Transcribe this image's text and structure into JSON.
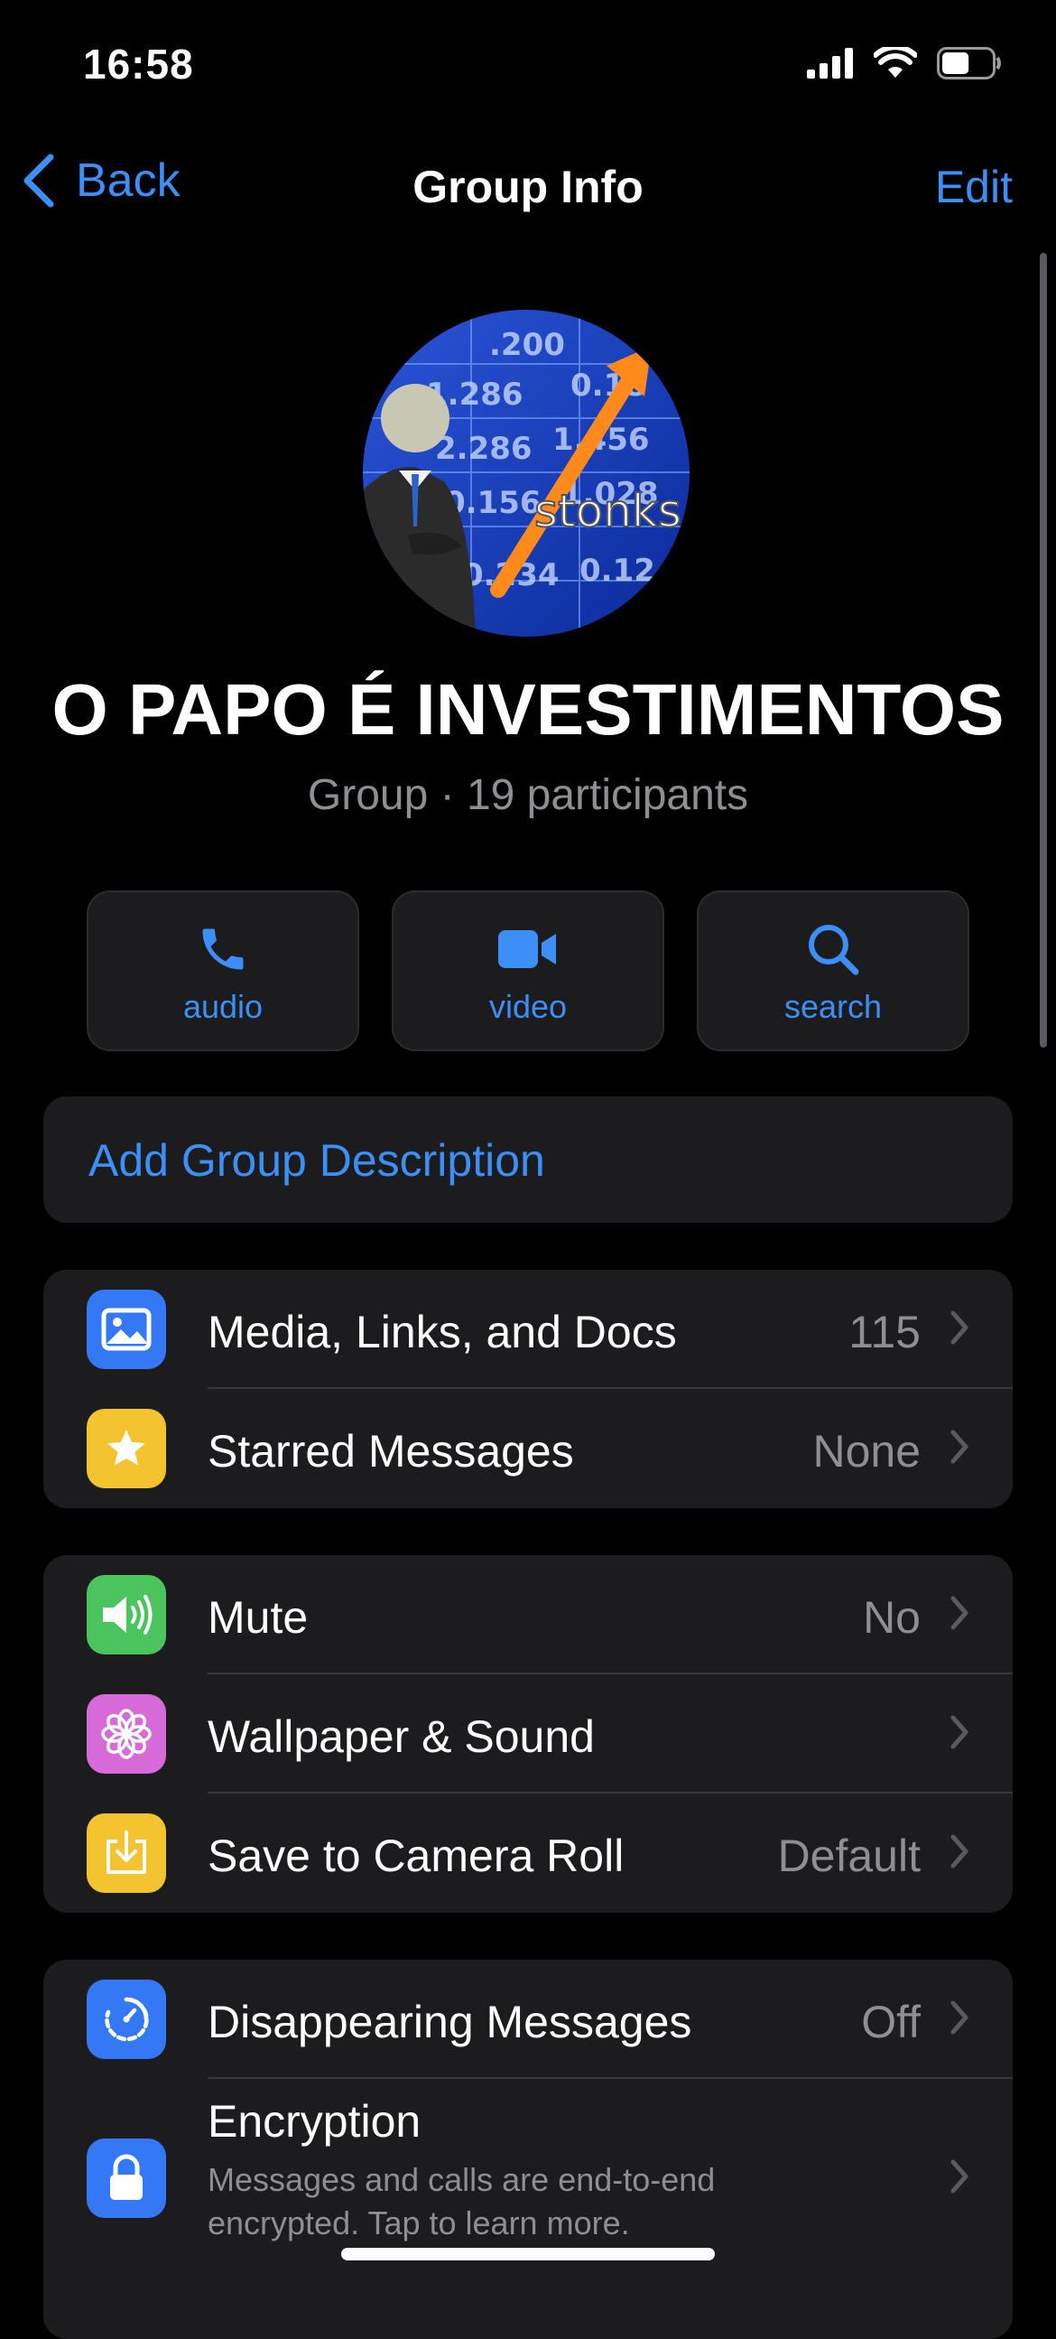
{
  "status_bar": {
    "time": "16:58",
    "battery_level": 0.55
  },
  "navbar": {
    "back_label": "Back",
    "title": "Group Info",
    "edit_label": "Edit"
  },
  "group": {
    "avatar_caption": "stonks",
    "name": "O PAPO É INVESTIMENTOS",
    "subtitle": "Group · 19 participants"
  },
  "actions": [
    {
      "label": "audio",
      "icon": "phone-icon"
    },
    {
      "label": "video",
      "icon": "video-camera-icon"
    },
    {
      "label": "search",
      "icon": "search-icon"
    }
  ],
  "description": {
    "label": "Add Group Description"
  },
  "section1": [
    {
      "label": "Media, Links, and Docs",
      "value": "115",
      "icon": "photo-icon",
      "color": "#3478f6"
    },
    {
      "label": "Starred Messages",
      "value": "None",
      "icon": "star-icon",
      "color": "#f4c430"
    }
  ],
  "section2": [
    {
      "label": "Mute",
      "value": "No",
      "icon": "speaker-icon",
      "color": "#4cc45e"
    },
    {
      "label": "Wallpaper & Sound",
      "value": "",
      "icon": "flower-icon",
      "color": "#d66ad8"
    },
    {
      "label": "Save to Camera Roll",
      "value": "Default",
      "icon": "download-icon",
      "color": "#f4c430"
    }
  ],
  "section3": [
    {
      "label": "Disappearing Messages",
      "value": "Off",
      "icon": "timer-icon",
      "color": "#3478f6"
    },
    {
      "label": "Encryption",
      "subtitle": "Messages and calls are end-to-end encrypted. Tap to learn more.",
      "icon": "lock-icon",
      "color": "#3478f6"
    }
  ],
  "colors": {
    "accent": "#3b8ff6",
    "background": "#000000",
    "card": "#1c1c1e",
    "secondary_text": "#8e8e93"
  }
}
